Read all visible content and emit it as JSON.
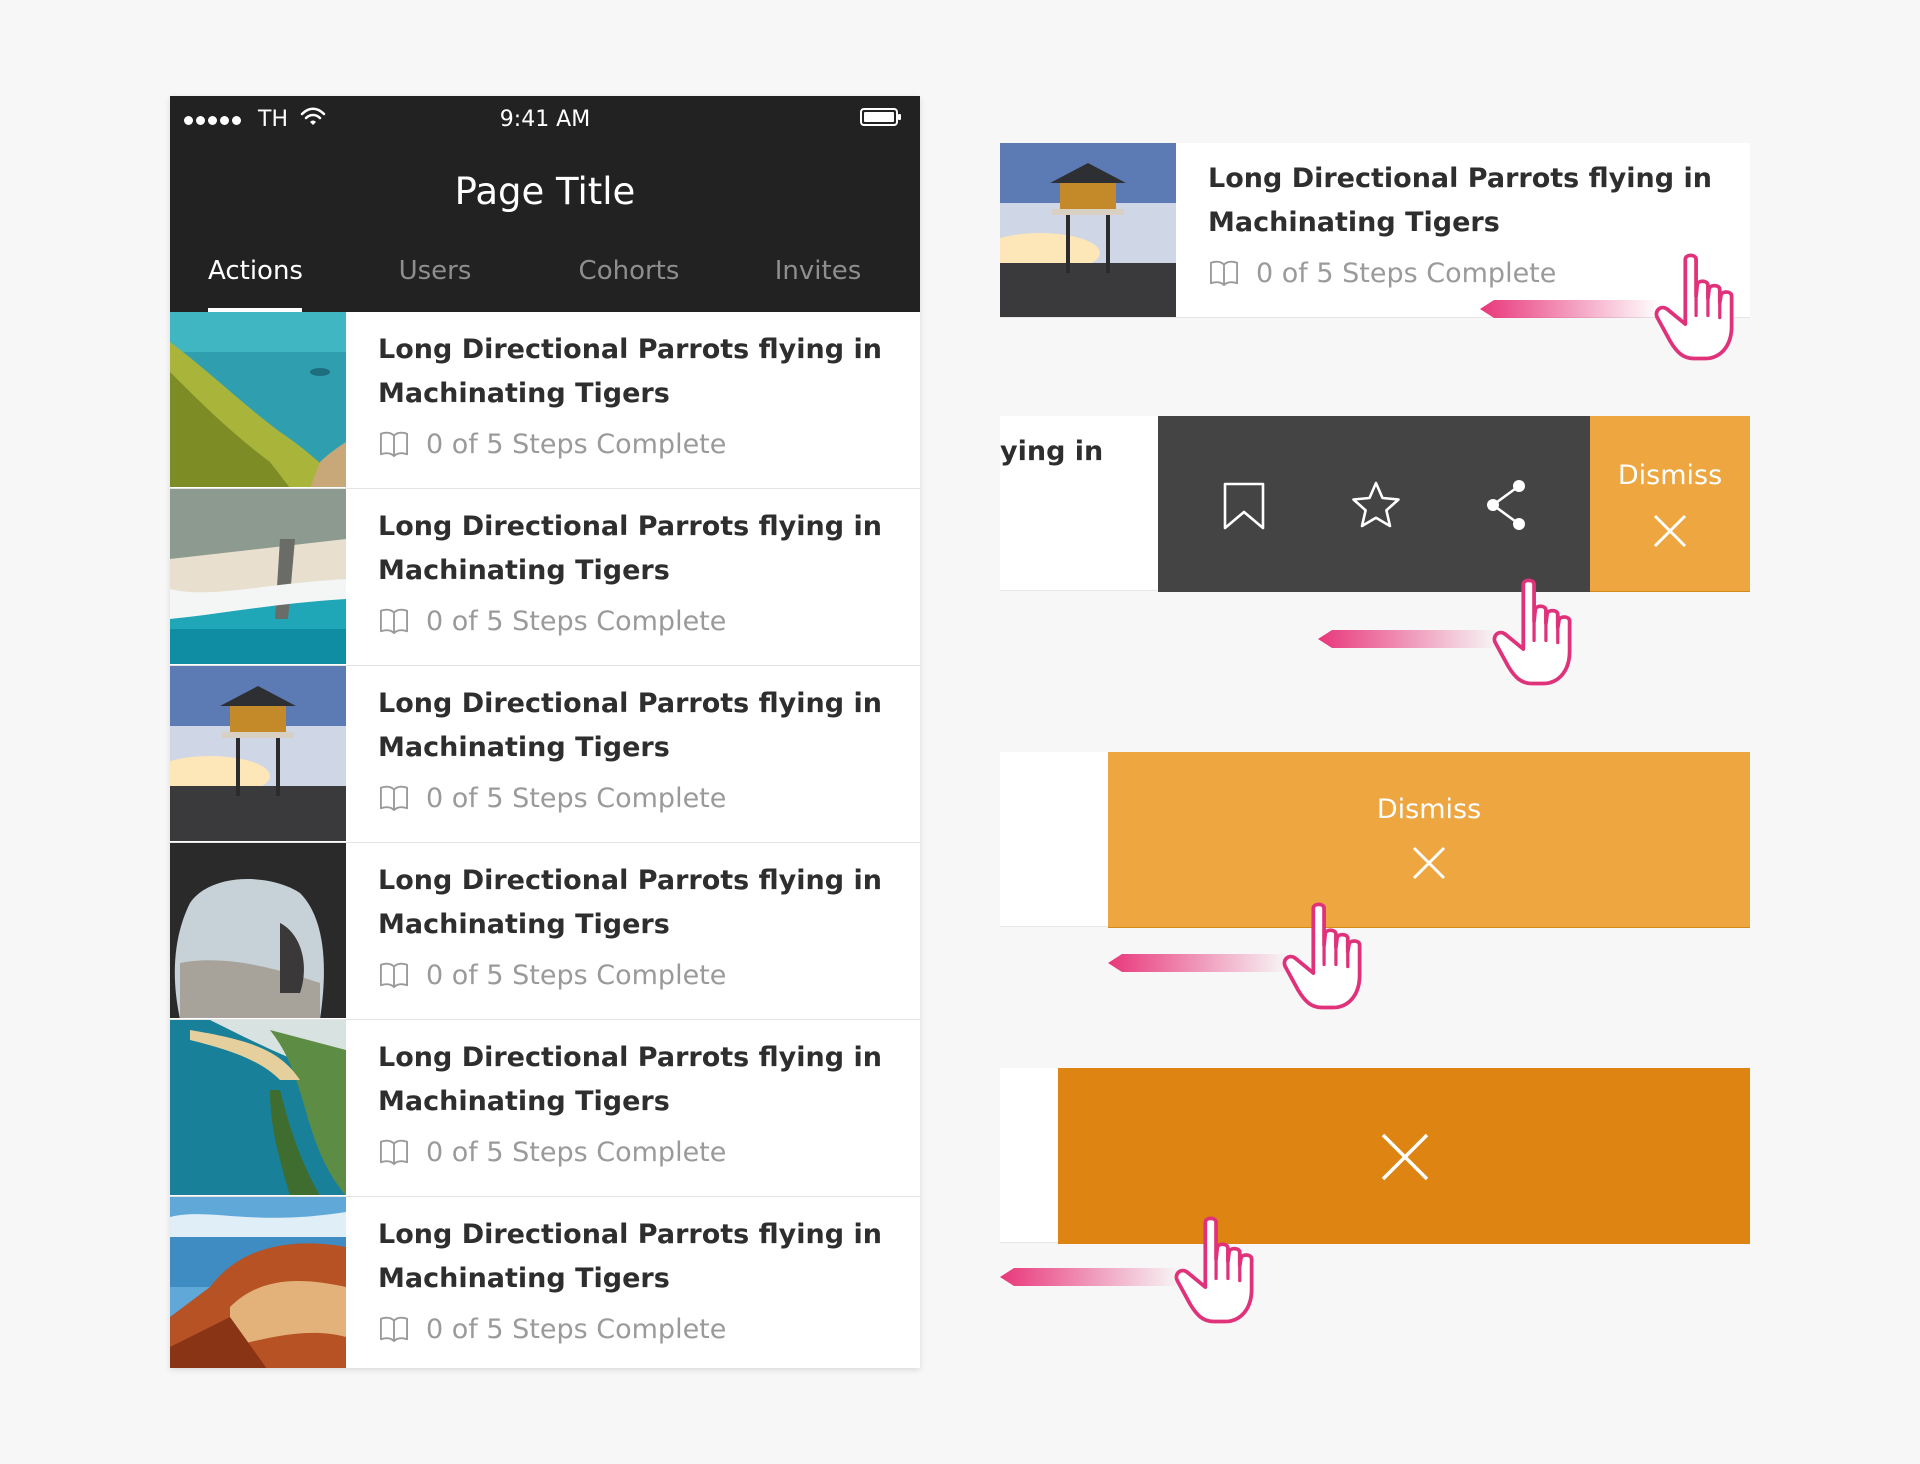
{
  "status_bar": {
    "carrier": "TH",
    "time": "9:41 AM"
  },
  "header": {
    "title": "Page Title"
  },
  "tabs": [
    {
      "label": "Actions",
      "active": true
    },
    {
      "label": "Users",
      "active": false
    },
    {
      "label": "Cohorts",
      "active": false
    },
    {
      "label": "Invites",
      "active": false
    }
  ],
  "items": [
    {
      "title": "Long Directional Parrots flying in Machinating Tigers",
      "progress": "0 of 5 Steps Complete",
      "image": "coastal-cliff"
    },
    {
      "title": "Long Directional Parrots flying in Machinating Tigers",
      "progress": "0 of 5 Steps Complete",
      "image": "aerial-beach"
    },
    {
      "title": "Long Directional Parrots flying in Machinating Tigers",
      "progress": "0 of 5 Steps Complete",
      "image": "lifeguard-tower"
    },
    {
      "title": "Long Directional Parrots flying in Machinating Tigers",
      "progress": "0 of 5 Steps Complete",
      "image": "sea-cave"
    },
    {
      "title": "Long Directional Parrots flying in Machinating Tigers",
      "progress": "0 of 5 Steps Complete",
      "image": "green-bay"
    },
    {
      "title": "Long Directional Parrots flying in Machinating Tigers",
      "progress": "0 of 5 Steps Complete",
      "image": "red-rocks"
    }
  ],
  "swipe_states": {
    "card": {
      "title": "Long Directional Parrots flying in Machinating Tigers",
      "progress": "0 of 5 Steps Complete",
      "image": "lifeguard-tower"
    },
    "revealed": {
      "visible_text": "ying in",
      "actions": [
        "bookmark-icon",
        "star-icon",
        "share-icon"
      ],
      "dismiss_label": "Dismiss"
    },
    "expanded": {
      "dismiss_label": "Dismiss"
    },
    "committed": {
      "icon": "close-icon"
    }
  },
  "colors": {
    "header_bg": "#222222",
    "dismiss_orange": "#eda640",
    "dismiss_committed": "#de8412",
    "action_panel": "#444444",
    "gesture_pink": "#e8377a"
  }
}
